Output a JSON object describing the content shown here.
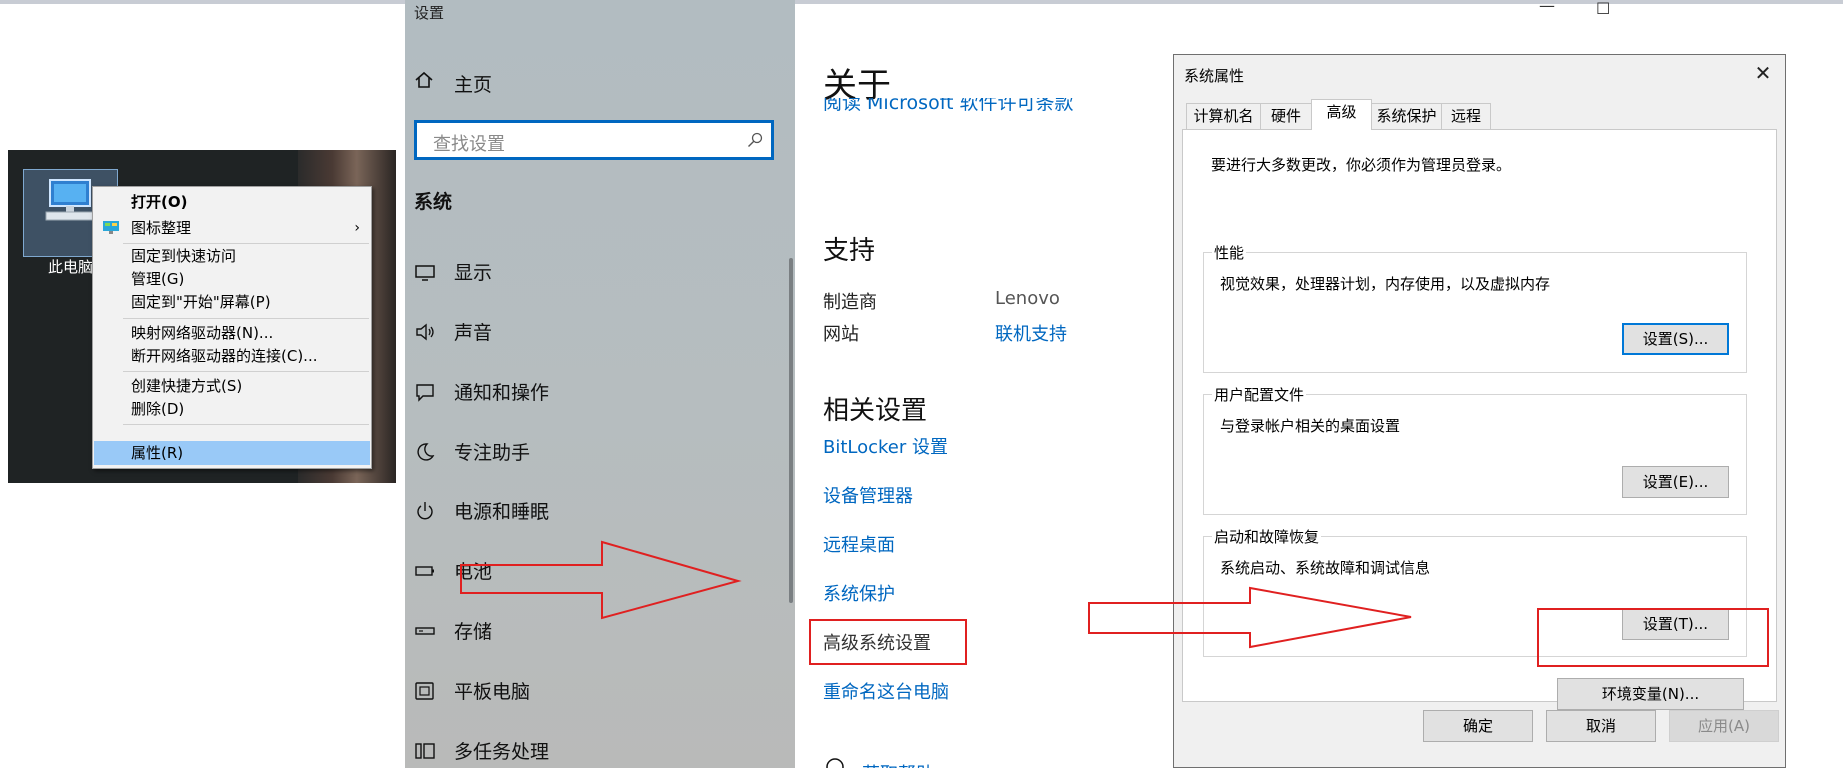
{
  "desktop": {
    "icon_label": "此电脑",
    "context_menu": [
      {
        "label": "打开(O)",
        "bold": true
      },
      {
        "label": "图标整理",
        "submenu": true
      },
      {
        "label": "固定到快速访问"
      },
      {
        "label": "管理(G)"
      },
      {
        "label": "固定到\"开始\"屏幕(P)"
      },
      {
        "label": "映射网络驱动器(N)..."
      },
      {
        "label": "断开网络驱动器的连接(C)..."
      },
      {
        "label": "创建快捷方式(S)"
      },
      {
        "label": "删除(D)"
      },
      {
        "label": "属性(R)",
        "selected": true
      }
    ],
    "submenu_arrow": "›"
  },
  "settings": {
    "window_title": "设置",
    "home_label": "主页",
    "search_placeholder": "查找设置",
    "section": "系统",
    "nav_items": [
      {
        "label": "显示",
        "icon": "monitor-icon"
      },
      {
        "label": "声音",
        "icon": "speaker-icon"
      },
      {
        "label": "通知和操作",
        "icon": "notification-icon"
      },
      {
        "label": "专注助手",
        "icon": "moon-icon"
      },
      {
        "label": "电源和睡眠",
        "icon": "power-icon"
      },
      {
        "label": "电池",
        "icon": "battery-icon"
      },
      {
        "label": "存储",
        "icon": "storage-icon"
      },
      {
        "label": "平板电脑",
        "icon": "tablet-icon"
      },
      {
        "label": "多任务处理",
        "icon": "multitask-icon"
      }
    ]
  },
  "about": {
    "title": "关于",
    "cut_link": "阅读 Microsoft 软件许可条款",
    "support_heading": "支持",
    "support": [
      {
        "label": "制造商",
        "value": "Lenovo",
        "is_link": false
      },
      {
        "label": "网站",
        "value": "联机支持",
        "is_link": true
      }
    ],
    "related_heading": "相关设置",
    "related_links": [
      {
        "label": "BitLocker 设置"
      },
      {
        "label": "设备管理器"
      },
      {
        "label": "远程桌面"
      },
      {
        "label": "系统保护"
      },
      {
        "label": "高级系统设置",
        "highlighted": true
      },
      {
        "label": "重命名这台电脑"
      }
    ],
    "help_link": "获取帮助"
  },
  "dialog": {
    "title": "系统属性",
    "close_glyph": "✕",
    "tabs": [
      {
        "label": "计算机名"
      },
      {
        "label": "硬件"
      },
      {
        "label": "高级",
        "active": true
      },
      {
        "label": "系统保护"
      },
      {
        "label": "远程"
      }
    ],
    "notice": "要进行大多数更改，你必须作为管理员登录。",
    "groups": [
      {
        "title": "性能",
        "desc": "视觉效果，处理器计划，内存使用，以及虚拟内存",
        "button": "设置(S)..."
      },
      {
        "title": "用户配置文件",
        "desc": "与登录帐户相关的桌面设置",
        "button": "设置(E)..."
      },
      {
        "title": "启动和故障恢复",
        "desc": "系统启动、系统故障和调试信息",
        "button": "设置(T)..."
      }
    ],
    "env_button": "环境变量(N)...",
    "ok_button": "确定",
    "cancel_button": "取消",
    "apply_button": "应用(A)"
  },
  "window_controls": {
    "minimize": "—",
    "maximize": "☐"
  }
}
